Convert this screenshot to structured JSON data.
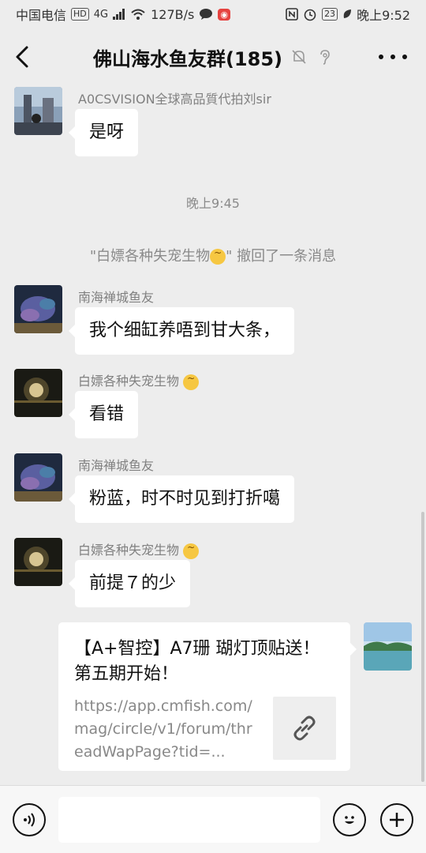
{
  "status_bar": {
    "carrier": "中国电信",
    "net_type": "HD",
    "signal": "4G",
    "speed": "127B/s",
    "battery": "23",
    "time": "晚上9:52"
  },
  "header": {
    "title": "佛山海水鱼友群(185)"
  },
  "messages": [
    {
      "sender": "A0CSVISION全球高品質代拍刘sir",
      "text": "是呀"
    },
    {
      "sender": "南海禅城鱼友",
      "text": "我个细缸养唔到甘大条，"
    },
    {
      "sender": "白嫖各种失宠生物",
      "text": "看错"
    },
    {
      "sender": "南海禅城鱼友",
      "text": "粉蓝，时不时见到打折噶"
    },
    {
      "sender": "白嫖各种失宠生物",
      "text": "前提７的少"
    }
  ],
  "system": {
    "time_divider": "晚上9:45",
    "recall_prefix": "\"白嫖各种失宠生物",
    "recall_suffix": "\" 撤回了一条消息"
  },
  "link_card": {
    "title": "【A+智控】A7珊 瑚灯顶贴送！第五期开始！",
    "url": "https://app.cmfish.com/mag/circle/v1/forum/threadWapPage?tid=..."
  },
  "colors": {
    "background": "#ededed",
    "bubble": "#ffffff",
    "meta_text": "#8a8a8a"
  }
}
